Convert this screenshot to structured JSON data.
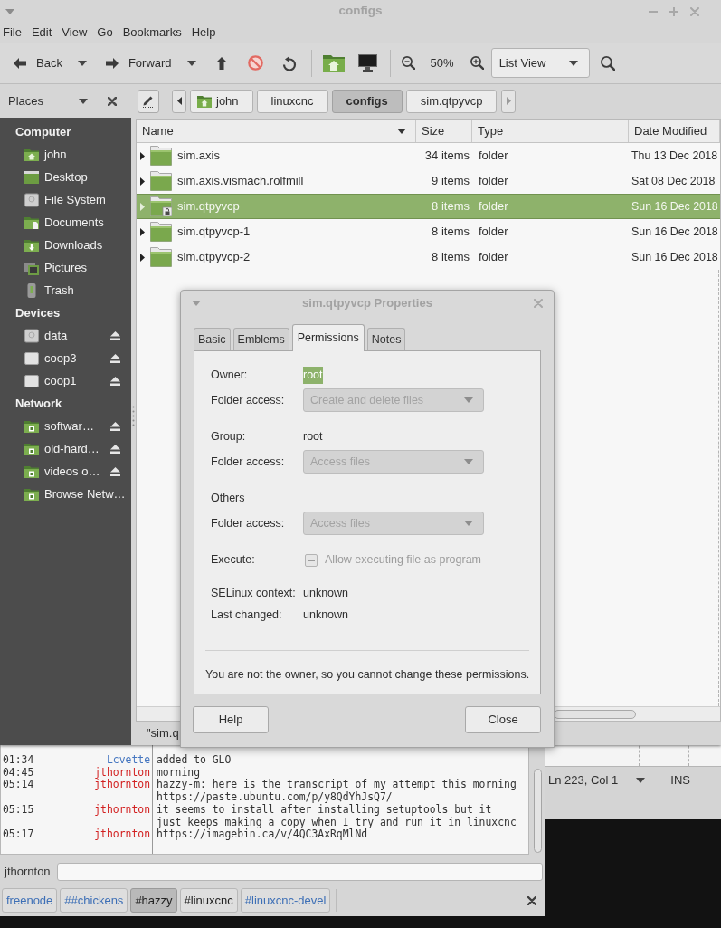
{
  "file_manager": {
    "title": "configs",
    "menu": [
      "File",
      "Edit",
      "View",
      "Go",
      "Bookmarks",
      "Help"
    ],
    "toolbar": {
      "back": "Back",
      "forward": "Forward",
      "zoom": "50%",
      "view": "List View"
    },
    "places": {
      "label": "Places",
      "sections": [
        {
          "heading": "Computer",
          "items": [
            {
              "label": "john",
              "ejectable": false
            },
            {
              "label": "Desktop",
              "ejectable": false
            },
            {
              "label": "File System",
              "ejectable": false
            },
            {
              "label": "Documents",
              "ejectable": false
            },
            {
              "label": "Downloads",
              "ejectable": false
            },
            {
              "label": "Pictures",
              "ejectable": false
            },
            {
              "label": "Trash",
              "ejectable": false
            }
          ]
        },
        {
          "heading": "Devices",
          "items": [
            {
              "label": "data",
              "ejectable": true
            },
            {
              "label": "coop3",
              "ejectable": true
            },
            {
              "label": "coop1",
              "ejectable": true
            }
          ]
        },
        {
          "heading": "Network",
          "items": [
            {
              "label": "softwar…",
              "ejectable": true
            },
            {
              "label": "old-hard…",
              "ejectable": true
            },
            {
              "label": "videos o…",
              "ejectable": true
            },
            {
              "label": "Browse Netw…",
              "ejectable": false
            }
          ]
        }
      ]
    },
    "path": [
      {
        "label": "john",
        "selected": false
      },
      {
        "label": "linuxcnc",
        "selected": false
      },
      {
        "label": "configs",
        "selected": true
      },
      {
        "label": "sim.qtpyvcp",
        "selected": false
      }
    ],
    "table": {
      "columns": [
        "Name",
        "Size",
        "Type",
        "Date Modified"
      ],
      "rows": [
        {
          "name": "sim.axis",
          "size": "34 items",
          "type": "folder",
          "date": "Thu 13 Dec 2018",
          "selected": false,
          "locked": false
        },
        {
          "name": "sim.axis.vismach.rolfmill",
          "size": "9 items",
          "type": "folder",
          "date": "Sat 08 Dec 2018",
          "selected": false,
          "locked": false
        },
        {
          "name": "sim.qtpyvcp",
          "size": "8 items",
          "type": "folder",
          "date": "Sun 16 Dec 2018",
          "selected": true,
          "locked": true
        },
        {
          "name": "sim.qtpyvcp-1",
          "size": "8 items",
          "type": "folder",
          "date": "Sun 16 Dec 2018",
          "selected": false,
          "locked": false
        },
        {
          "name": "sim.qtpyvcp-2",
          "size": "8 items",
          "type": "folder",
          "date": "Sun 16 Dec 2018",
          "selected": false,
          "locked": false
        }
      ]
    },
    "status": "\"sim.q"
  },
  "properties_dialog": {
    "title": "sim.qtpyvcp Properties",
    "tabs": [
      {
        "label": "Basic",
        "selected": false
      },
      {
        "label": "Emblems",
        "selected": false
      },
      {
        "label": "Permissions",
        "selected": true
      },
      {
        "label": "Notes",
        "selected": false
      }
    ],
    "sections": [
      {
        "rows": [
          {
            "kind": "value",
            "label": "Owner:",
            "value": "root",
            "highlighted": true
          },
          {
            "kind": "dropdown",
            "label": "Folder access:",
            "value": "Create and delete files",
            "disabled": true
          }
        ]
      },
      {
        "rows": [
          {
            "kind": "value",
            "label": "Group:",
            "value": "root",
            "highlighted": false
          },
          {
            "kind": "dropdown",
            "label": "Folder access:",
            "value": "Access files",
            "disabled": true
          }
        ]
      },
      {
        "rows": [
          {
            "kind": "heading",
            "label": "Others"
          },
          {
            "kind": "dropdown",
            "label": "Folder access:",
            "value": "Access files",
            "disabled": true
          }
        ]
      },
      {
        "rows": [
          {
            "kind": "checkbox",
            "label": "Execute:",
            "value": "Allow executing file as program",
            "inconsistent": true,
            "disabled": true
          }
        ]
      },
      {
        "rows": [
          {
            "kind": "value",
            "label": "SELinux context:",
            "value": "unknown",
            "highlighted": false
          },
          {
            "kind": "value",
            "label": "Last changed:",
            "value": "unknown",
            "highlighted": false
          }
        ]
      }
    ],
    "notice": "You are not the owner, so you cannot change these permissions.",
    "buttons": [
      "Help",
      "Close"
    ]
  },
  "chat": {
    "messages": [
      {
        "time": "01:34",
        "nick": "Lcvette",
        "color": "#4576c0",
        "text": "added to GLO"
      },
      {
        "time": "04:45",
        "nick": "jthornton",
        "color": "#d21f1f",
        "text": "morning"
      },
      {
        "time": "05:14",
        "nick": "jthornton",
        "color": "#d21f1f",
        "text": "hazzy-m: here is the transcript of my attempt this morning https://paste.ubuntu.com/p/y8QdYhJsQ7/"
      },
      {
        "time": "05:15",
        "nick": "jthornton",
        "color": "#d21f1f",
        "text": "it seems to install after installing setuptools but it just keeps making a copy when I try and run it in linuxcnc"
      },
      {
        "time": "05:17",
        "nick": "jthornton",
        "color": "#d21f1f",
        "text": "https://imagebin.ca/v/4QC3AxRqMlNd"
      }
    ],
    "nick": "jthornton",
    "tabs": [
      {
        "label": "freenode",
        "selected": false,
        "color": "#3d6fb6"
      },
      {
        "label": "##chickens",
        "selected": false,
        "color": "#3d6fb6"
      },
      {
        "label": "#hazzy",
        "selected": true,
        "color": "#222222"
      },
      {
        "label": "#linuxcnc",
        "selected": false,
        "color": "#222222"
      },
      {
        "label": "#linuxcnc-devel",
        "selected": false,
        "color": "#3d6fb6"
      }
    ]
  },
  "editor": {
    "position": "Ln 223, Col 1",
    "mode": "INS"
  }
}
